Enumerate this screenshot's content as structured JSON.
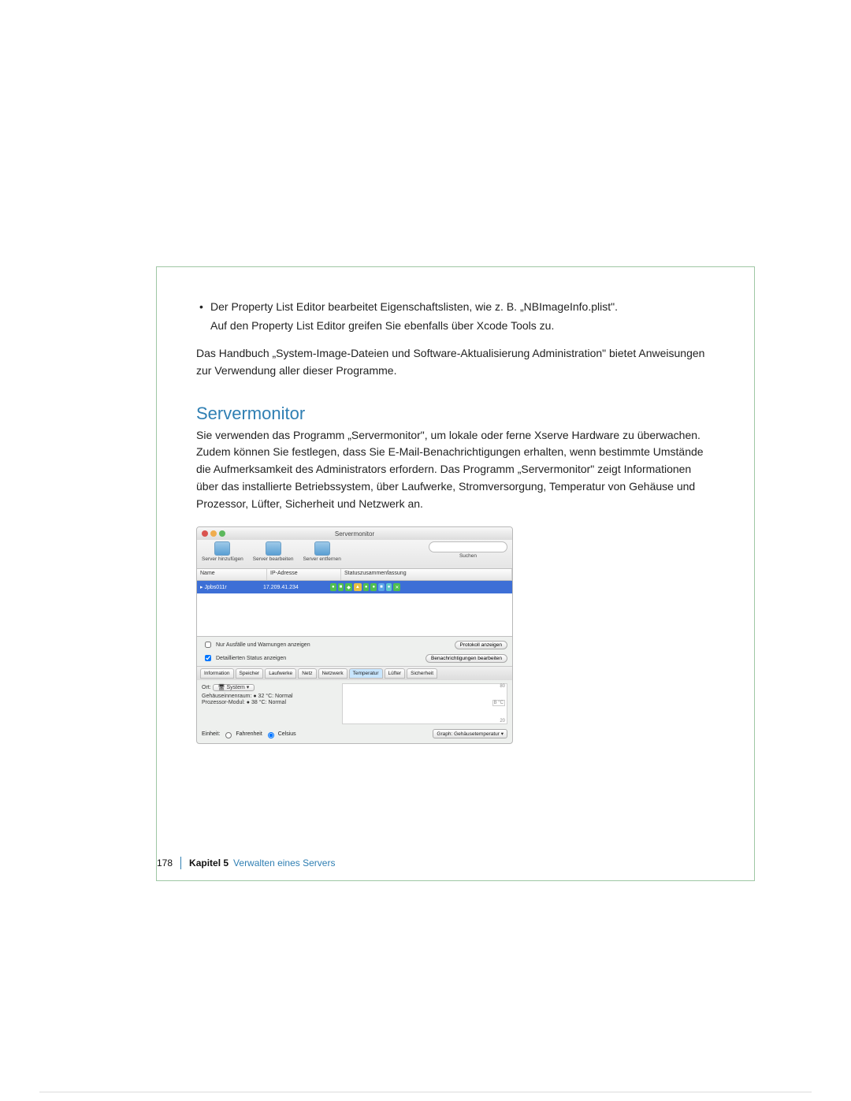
{
  "body": {
    "bullet1_a": "Der Property List Editor bearbeitet Eigenschaftslisten, wie z. B. „NBImageInfo.plist\".",
    "bullet1_b": "Auf den Property List Editor greifen Sie ebenfalls über Xcode Tools zu.",
    "para1": "Das Handbuch „System-Image-Dateien und Software-Aktualisierung Administration\" bietet Anweisungen zur Verwendung aller dieser Programme.",
    "heading": "Servermonitor",
    "para2": "Sie verwenden das Programm „Servermonitor\", um lokale oder ferne Xserve Hardware zu überwachen. Zudem können Sie festlegen, dass Sie E-Mail-Benachrichtigungen erhalten, wenn bestimmte Umstände die Aufmerksamkeit des Administrators erfordern. Das Programm „Servermonitor\" zeigt Informationen über das installierte Betriebssystem, über Laufwerke, Stromversorgung, Temperatur von Gehäuse und Prozessor, Lüfter, Sicherheit und Netzwerk an."
  },
  "app": {
    "title": "Servermonitor",
    "toolbar": {
      "add": "Server hinzufügen",
      "edit": "Server bearbeiten",
      "remove": "Server entfernen",
      "search_label": "Suchen",
      "search_placeholder": ""
    },
    "columns": {
      "name": "Name",
      "ip": "IP-Adresse",
      "status": "Statuszusammenfassung"
    },
    "row": {
      "name": "Jpbs011r",
      "ip": "17.209.41.234"
    },
    "opts": {
      "only_fail": "Nur Ausfälle und Warnungen anzeigen",
      "detailed": "Detaillierten Status anzeigen",
      "btn_show": "Protokoll anzeigen",
      "btn_notify": "Benachrichtigungen bearbeiten"
    },
    "tabs": [
      "Information",
      "Speicher",
      "Laufwerke",
      "Netz",
      "Netzwerk",
      "Temperatur",
      "Lüfter",
      "Sicherheit"
    ],
    "active_tab": 5,
    "detail": {
      "ort_label": "Ort:",
      "ort_select": "System",
      "line1": "Gehäuseinnenraum: ● 32 °C: Normal",
      "line2": "Prozessor-Modul: ● 38 °C: Normal",
      "ylabels": [
        "80",
        "B °C",
        "20"
      ]
    },
    "units": {
      "label": "Einheit:",
      "fahrenheit": "Fahrenheit",
      "celsius": "Celsius"
    },
    "graph": {
      "label": "Graph:",
      "select": "Gehäusetemperatur"
    }
  },
  "footer": {
    "page": "178",
    "chapter": "Kapitel 5",
    "title": "Verwalten eines Servers"
  }
}
